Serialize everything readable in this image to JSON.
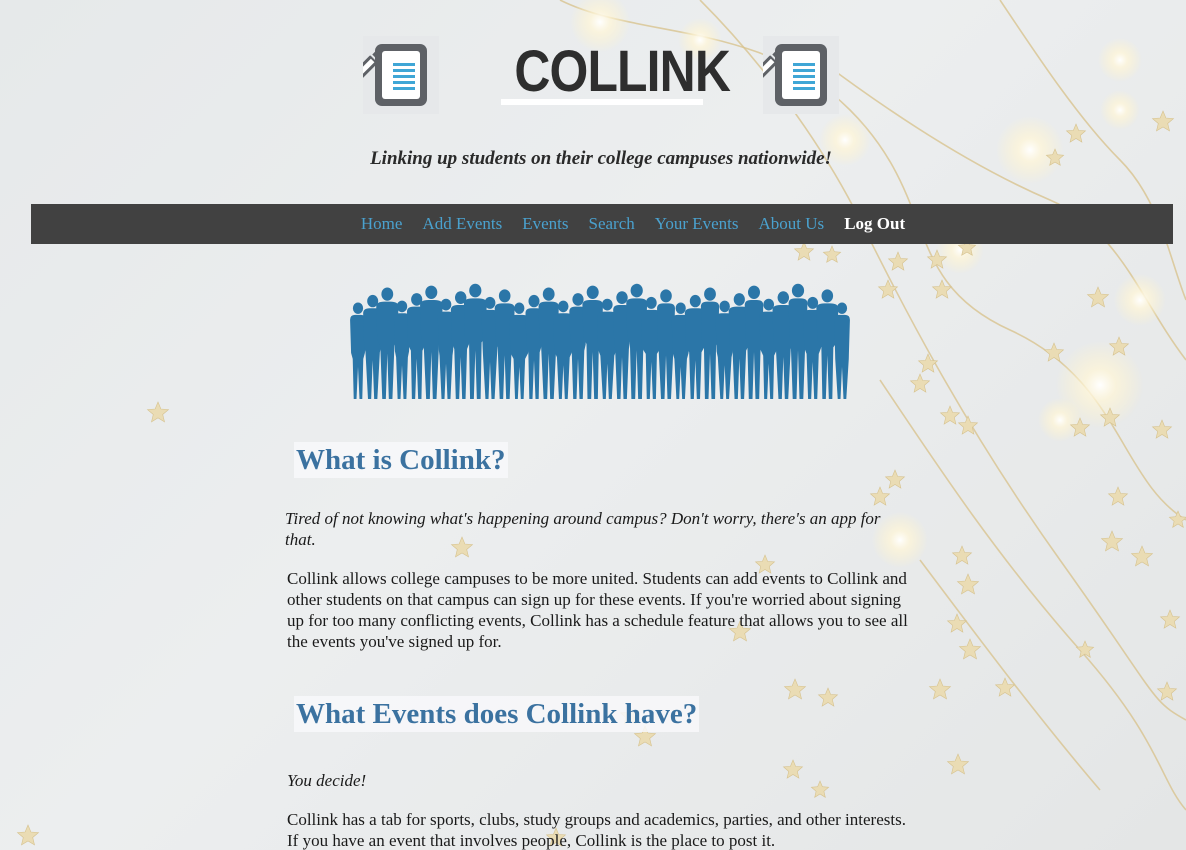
{
  "header": {
    "title": "COLLINK",
    "left_icon": "document-pencil-icon",
    "right_icon": "document-pencil-icon",
    "tagline": "Linking up students on their college campuses nationwide!"
  },
  "nav": {
    "items": [
      {
        "label": "Home"
      },
      {
        "label": "Add Events"
      },
      {
        "label": "Events"
      },
      {
        "label": "Search"
      },
      {
        "label": "Your Events"
      },
      {
        "label": "About Us"
      },
      {
        "label": "Log Out"
      }
    ]
  },
  "banner": {
    "icon": "crowd-silhouette-banner"
  },
  "sections": [
    {
      "heading": "What is Collink?",
      "lead": "Tired of not knowing what's happening around campus? Don't worry, there's an app for that.",
      "body": "Collink allows college campuses to be more united. Students can add events to Collink and other students on that campus can sign up for these events. If you're worried about signing up for too many conflicting events, Collink has a schedule feature that allows you to see all the events you've signed up for."
    },
    {
      "heading": "What Events does Collink have?",
      "lead": "You decide!",
      "body": "Collink has a tab for sports, clubs, study groups and academics, parties, and other interests. If you have an event that involves people, Collink is the place to post it."
    }
  ],
  "colors": {
    "nav_bg": "#414141",
    "nav_link": "#4aa1ce",
    "nav_active": "#ffffff",
    "heading": "#3b72a0",
    "silhouette": "#2b76a8",
    "icon_gray": "#5e6166",
    "icon_lines": "#3fa6d6"
  }
}
